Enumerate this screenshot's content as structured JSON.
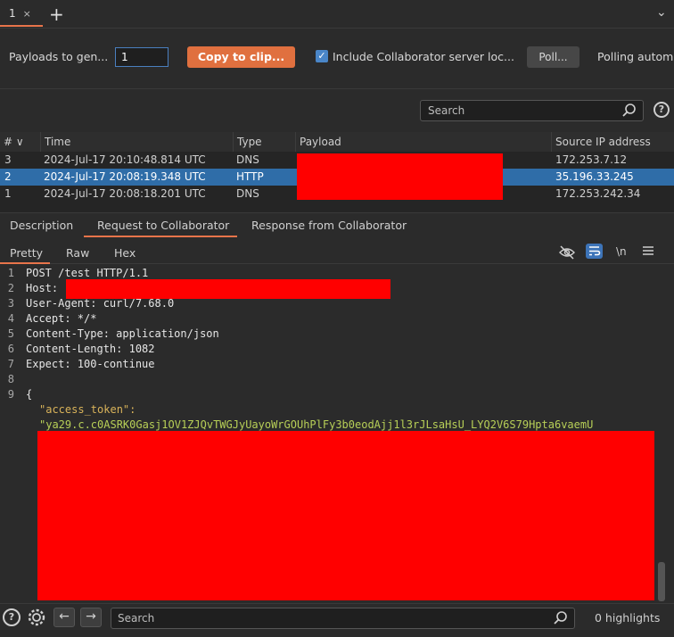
{
  "tabs": {
    "items": [
      {
        "label": "1",
        "close": "×"
      }
    ],
    "add": "+",
    "more": "⌄"
  },
  "toolbar": {
    "payloads_label": "Payloads to gen...",
    "payloads_value": "1",
    "copy_label": "Copy to clip...",
    "include_label": "Include Collaborator server loc...",
    "include_checked": true,
    "poll_label": "Poll...",
    "polling_label": "Polling automa"
  },
  "filter": {
    "search_placeholder": "Search",
    "help": "?"
  },
  "table": {
    "headers": [
      "#",
      "Time",
      "Type",
      "Payload",
      "Source IP address"
    ],
    "rows": [
      {
        "num": "3",
        "time": "2024-Jul-17 20:10:48.814 UTC",
        "type": "DNS",
        "ip": "172.253.7.12",
        "selected": false
      },
      {
        "num": "2",
        "time": "2024-Jul-17 20:08:19.348 UTC",
        "type": "HTTP",
        "ip": "35.196.33.245",
        "selected": true
      },
      {
        "num": "1",
        "time": "2024-Jul-17 20:08:18.201 UTC",
        "type": "DNS",
        "ip": "172.253.242.34",
        "selected": false
      }
    ]
  },
  "detail_tabs": [
    "Description",
    "Request to Collaborator",
    "Response from Collaborator"
  ],
  "sub_tabs": [
    "Pretty",
    "Raw",
    "Hex"
  ],
  "editor_tools": {
    "newline": "\\n"
  },
  "code": {
    "lines": [
      {
        "n": "1",
        "text": "POST /test HTTP/1.1"
      },
      {
        "n": "2",
        "text": "Host: "
      },
      {
        "n": "3",
        "text": "User-Agent: curl/7.68.0"
      },
      {
        "n": "4",
        "text": "Accept: */*"
      },
      {
        "n": "5",
        "text": "Content-Type: application/json"
      },
      {
        "n": "6",
        "text": "Content-Length: 1082"
      },
      {
        "n": "7",
        "text": "Expect: 100-continue"
      },
      {
        "n": "8",
        "text": ""
      },
      {
        "n": "9",
        "text": "{"
      }
    ],
    "json_key": "\"access_token\":",
    "json_value": "\"ya29.c.c0ASRK0Gasj1OV1ZJQvTWGJyUayoWrGOUhPlFy3b0eodAjj1l3rJLsaHsU_LYQ2V6S79Hpta6vaemU"
  },
  "bottom": {
    "help": "?",
    "search_placeholder": "Search",
    "highlights": "0 highlights",
    "back": "←",
    "forward": "→"
  },
  "colors": {
    "accent": "#e8744a",
    "selected_row": "#2f6da8",
    "redaction": "#ff0000",
    "copy_button": "#e0703f"
  }
}
